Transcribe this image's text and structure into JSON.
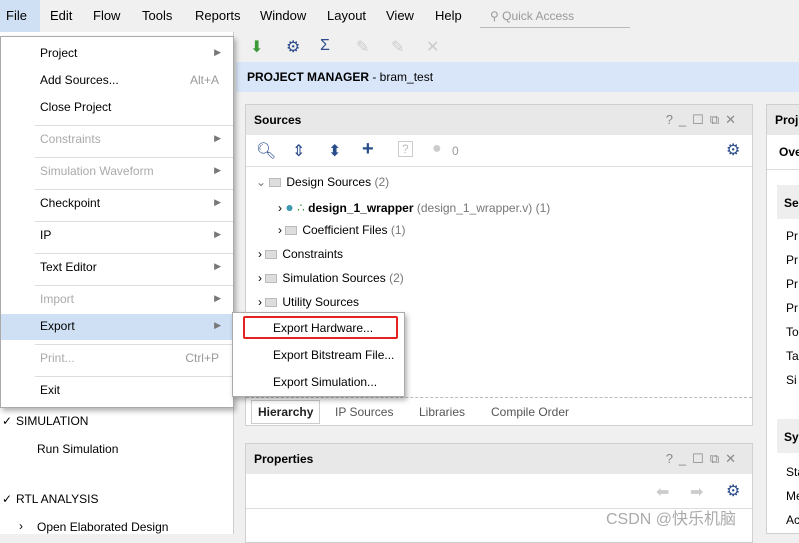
{
  "menubar": {
    "items": [
      "File",
      "Edit",
      "Flow",
      "Tools",
      "Reports",
      "Window",
      "Layout",
      "View",
      "Help"
    ],
    "quick_access_placeholder": "Quick Access"
  },
  "header": {
    "title": "PROJECT MANAGER",
    "project": " - bram_test"
  },
  "file_menu": [
    {
      "label": "Project",
      "submenu": true
    },
    {
      "label": "Add Sources...",
      "shortcut": "Alt+A"
    },
    {
      "label": "Close Project"
    },
    {
      "label": "Constraints",
      "disabled": true,
      "submenu": true
    },
    {
      "label": "Simulation Waveform",
      "disabled": true,
      "submenu": true
    },
    {
      "label": "Checkpoint",
      "submenu": true
    },
    {
      "label": "IP",
      "submenu": true
    },
    {
      "label": "Text Editor",
      "submenu": true
    },
    {
      "label": "Import",
      "disabled": true,
      "submenu": true
    },
    {
      "label": "Export",
      "submenu": true,
      "selected": true
    },
    {
      "label": "Print...",
      "shortcut": "Ctrl+P",
      "disabled": true
    },
    {
      "label": "Exit"
    }
  ],
  "export_submenu": [
    "Export Hardware...",
    "Export Bitstream File...",
    "Export Simulation..."
  ],
  "left_nav": {
    "simulation": "SIMULATION",
    "run_simulation": "Run Simulation",
    "rtl": "RTL ANALYSIS",
    "open_elab": "Open Elaborated Design"
  },
  "sources": {
    "title": "Sources",
    "warn_count": "0",
    "tree": {
      "design": "Design Sources",
      "design_count": "(2)",
      "wrapper": "design_1_wrapper",
      "wrapper_file": "(design_1_wrapper.v) (1)",
      "coef": "Coefficient Files",
      "coef_count": "(1)",
      "constraints": "Constraints",
      "sim": "Simulation Sources",
      "sim_count": "(2)",
      "util": "Utility Sources"
    },
    "tabs": [
      "Hierarchy",
      "IP Sources",
      "Libraries",
      "Compile Order"
    ]
  },
  "properties": {
    "title": "Properties"
  },
  "right_panel": {
    "title": "Proj",
    "tab": "Ove",
    "sec1": "Se",
    "rows1": [
      "Pr",
      "Pr",
      "Pr",
      "Pr",
      "To",
      "Ta",
      "Si"
    ],
    "sec2": "Sy",
    "rows2": [
      "Sta",
      "Me",
      "Ac"
    ]
  },
  "watermark": "CSDN @快乐机脑",
  "colors": {
    "accent": "#2b4c8b",
    "selection": "#cfe0f5",
    "highlight_box": "#e52222"
  }
}
